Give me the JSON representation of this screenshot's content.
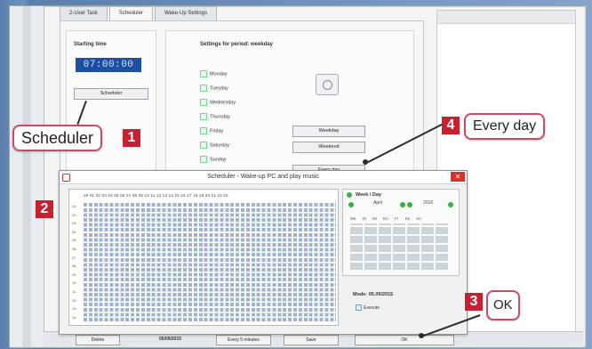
{
  "window": {
    "tabs": [
      "2-User Task",
      "Scheduler",
      "Wake-Up Settings"
    ]
  },
  "scheduler_tab": {
    "starting_time_label": "Starting time",
    "starting_time_value": "07:00:00",
    "scheduler_button": "Scheduler",
    "settings_title": "Settings for period: weekday",
    "days": [
      "Monday",
      "Tuesday",
      "Wednesday",
      "Thursday",
      "Friday",
      "Saturday",
      "Sunday"
    ],
    "weekday_button": "Weekday",
    "weekend_button": "Weekend",
    "everyday_button": "Every day"
  },
  "dialog": {
    "title": "Scheduler - Wake-up PC and play music",
    "close_glyph": "✕",
    "hours_header": "00 01 02 03 04 05 06 07 08 09 10 11 12 13 14 15 16 17 18 19 20 21 22 23",
    "row_labels": [
      "01",
      "02",
      "03",
      "04",
      "05",
      "06",
      "07",
      "08",
      "09",
      "10",
      "11",
      "12",
      "13",
      "14"
    ],
    "calendar": {
      "title": "Week / Day",
      "month": "April",
      "year": "2016",
      "weekdays": "Mo Di Mi Do Fr Sa So"
    },
    "mode_label": "Mode: 05.09/2015",
    "execute_label": "Execute"
  },
  "bottom_bar": {
    "delete_button": "Delete",
    "date_text": "05/09/2015",
    "dropdown_value": "Every 5 minutes",
    "save_button": "Save",
    "ok_button": "OK"
  },
  "callouts": [
    {
      "number": "1",
      "text": "Scheduler"
    },
    {
      "number": "2",
      "text": ""
    },
    {
      "number": "3",
      "text": "OK"
    },
    {
      "number": "4",
      "text": "Every day"
    }
  ],
  "colors": {
    "accent_red": "#c8202f",
    "callout_border": "#c94c66",
    "time_display": "#1a4fa3"
  }
}
